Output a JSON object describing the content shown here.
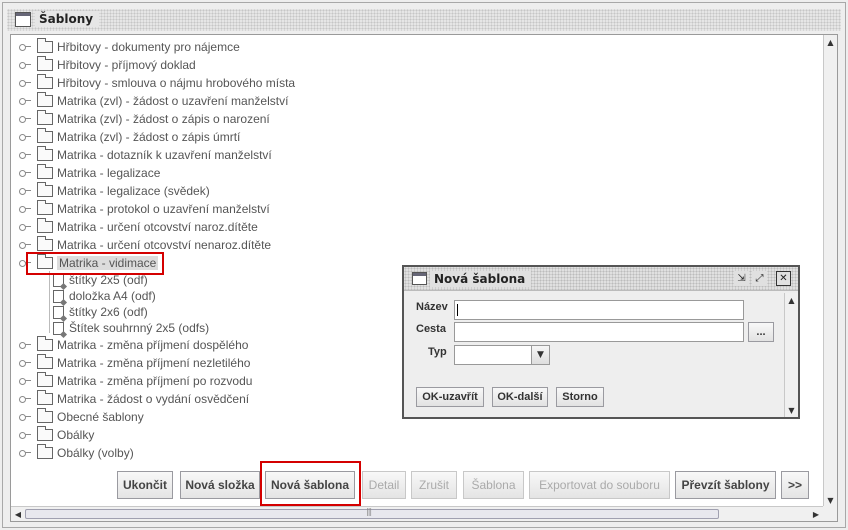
{
  "window": {
    "title": "Šablony"
  },
  "tree": {
    "items": [
      {
        "label": "Hřbitovy - dokumenty pro nájemce"
      },
      {
        "label": "Hřbitovy - příjmový doklad"
      },
      {
        "label": "Hřbitovy - smlouva o nájmu hrobového místa"
      },
      {
        "label": "Matrika (zvl) - žádost o uzavření manželství"
      },
      {
        "label": "Matrika (zvl) - žádost o zápis o narození"
      },
      {
        "label": "Matrika (zvl) - žádost o zápis úmrtí"
      },
      {
        "label": "Matrika - dotazník k uzavření manželství"
      },
      {
        "label": "Matrika - legalizace"
      },
      {
        "label": "Matrika - legalizace (svědek)"
      },
      {
        "label": "Matrika - protokol o uzavření manželství"
      },
      {
        "label": "Matrika - určení otcovství naroz.dítěte"
      },
      {
        "label": "Matrika - určení otcovství nenaroz.dítěte"
      },
      {
        "label": "Matrika - vidimace"
      },
      {
        "label": "Matrika - změna příjmení dospělého"
      },
      {
        "label": "Matrika - změna příjmení nezletilého"
      },
      {
        "label": "Matrika - změna příjmení po rozvodu"
      },
      {
        "label": "Matrika - žádost o vydání osvědčení"
      },
      {
        "label": "Obecné šablony"
      },
      {
        "label": "Obálky"
      },
      {
        "label": "Obálky (volby)"
      }
    ],
    "children": [
      {
        "label": "štítky 2x5 (odf)"
      },
      {
        "label": "doložka A4 (odf)"
      },
      {
        "label": "štítky 2x6 (odf)"
      },
      {
        "label": "Štítek souhrnný 2x5 (odfs)"
      }
    ]
  },
  "buttons": {
    "ukoncit": "Ukončit",
    "nova_slozka": "Nová složka",
    "nova_sablona": "Nová šablona",
    "detail": "Detail",
    "zrusit": "Zrušit",
    "sablona": "Šablona",
    "exportovat": "Exportovat do souboru",
    "prevzit": "Převzít šablony",
    "more": ">>"
  },
  "dialog": {
    "title": "Nová šablona",
    "nazev_label": "Název",
    "nazev_value": "",
    "cesta_label": "Cesta",
    "cesta_value": "",
    "browse": "...",
    "typ_label": "Typ",
    "typ_value": "",
    "ok_zavrit": "OK-uzavřít",
    "ok_dalsi": "OK-další",
    "storno": "Storno"
  },
  "colors": {
    "highlight": "#d40000"
  }
}
